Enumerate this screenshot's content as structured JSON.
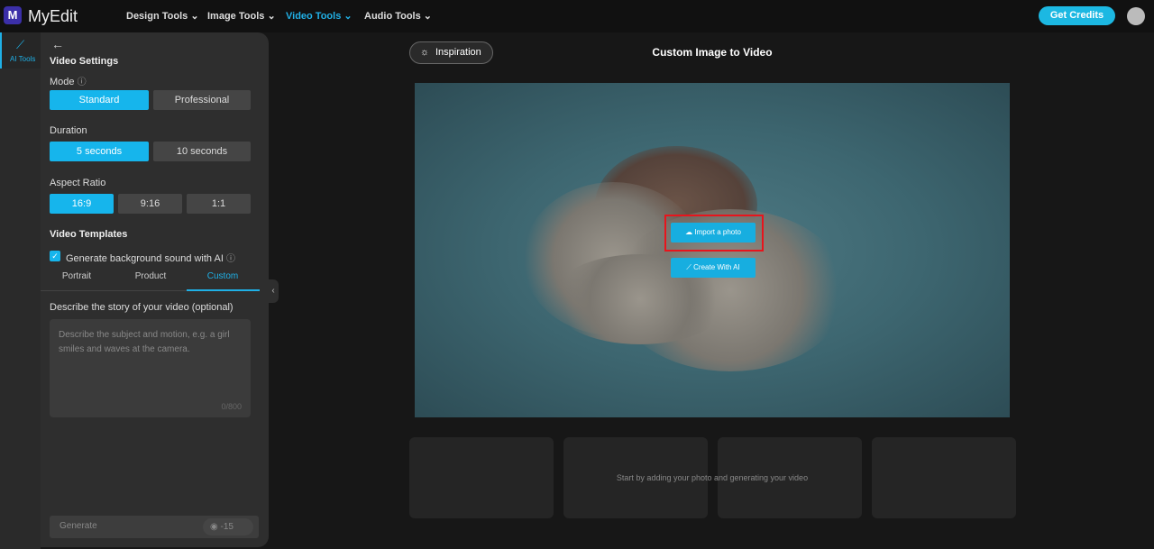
{
  "header": {
    "logo": "M",
    "brand": "MyEdit",
    "nav": [
      "Design Tools",
      "Image Tools",
      "Video Tools",
      "Audio Tools"
    ],
    "active_nav": "Video Tools",
    "credits": "Get Credits"
  },
  "rail": {
    "item": "AI Tools",
    "icon": "magic-wand-icon"
  },
  "panel": {
    "title": "Video Settings",
    "mode_label": "Mode",
    "modes": [
      "Standard",
      "Professional"
    ],
    "duration_label": "Duration",
    "durations": [
      "5 seconds",
      "10 seconds"
    ],
    "aspect_label": "Aspect Ratio",
    "aspects": [
      "16:9",
      "9:16",
      "1:1"
    ],
    "templates_label": "Video Templates",
    "bg_sound": "Generate background sound with AI",
    "bg_sound_checked": true,
    "tabs": [
      "Portrait",
      "Product",
      "Custom"
    ],
    "active_tab": "Custom",
    "story_label": "Describe the story of your video (optional)",
    "story_placeholder": "Describe the subject and motion, e.g. a girl smiles and waves at the camera.",
    "char_count": "0/800",
    "generate": "Generate",
    "cost": "-15"
  },
  "main": {
    "inspiration": "Inspiration",
    "title": "Custom Image to Video",
    "import": "Import a photo",
    "create_ai": "Create With AI",
    "hint": "Start by adding your photo and generating your video"
  },
  "colors": {
    "accent": "#16b5ec",
    "highlight": "#e8141c"
  }
}
